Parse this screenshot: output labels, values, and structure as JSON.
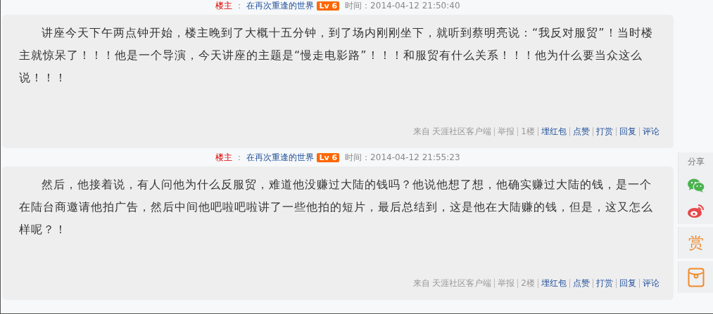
{
  "posts": [
    {
      "author_label": "楼主",
      "separator": "：",
      "author": "在再次重逢的世界",
      "level": "Lv 6",
      "time": "时间：2014-04-12 21:50:40",
      "body": "讲座今天下午两点钟开始，楼主晚到了大概十五分钟，到了场内刚刚坐下，就听到蔡明亮说：“我反对服贸”！当时楼主就惊呆了！！！他是一个导演，今天讲座的主题是“慢走电影路”！！！和服贸有什么关系！！！他为什么要当众这么说！！！",
      "footer": [
        {
          "kind": "text",
          "label": "来自 天涯社区客户端"
        },
        {
          "kind": "text",
          "label": "举报"
        },
        {
          "kind": "text",
          "label": "1楼"
        },
        {
          "kind": "link",
          "label": "埋红包"
        },
        {
          "kind": "link",
          "label": "点赞"
        },
        {
          "kind": "link",
          "label": "打赏"
        },
        {
          "kind": "link",
          "label": "回复"
        },
        {
          "kind": "link",
          "label": "评论"
        }
      ]
    },
    {
      "author_label": "楼主",
      "separator": "：",
      "author": "在再次重逢的世界",
      "level": "Lv 6",
      "time": "时间：2014-04-12 21:55:23",
      "body": "然后，他接着说，有人问他为什么反服贸，难道他没赚过大陆的钱吗？他说他想了想，他确实赚过大陆的钱，是一个在陆台商邀请他拍广告，然后中间他吧啦吧啦讲了一些他拍的短片，最后总结到，这是他在大陆赚的钱，但是，这又怎么样呢？！",
      "footer": [
        {
          "kind": "text",
          "label": "来自 天涯社区客户端"
        },
        {
          "kind": "text",
          "label": "举报"
        },
        {
          "kind": "text",
          "label": "2楼"
        },
        {
          "kind": "link",
          "label": "埋红包"
        },
        {
          "kind": "link",
          "label": "点赞"
        },
        {
          "kind": "link",
          "label": "打赏"
        },
        {
          "kind": "link",
          "label": "回复"
        },
        {
          "kind": "link",
          "label": "评论"
        }
      ]
    }
  ],
  "share_bar": {
    "title": "分享",
    "reward": "赏"
  }
}
